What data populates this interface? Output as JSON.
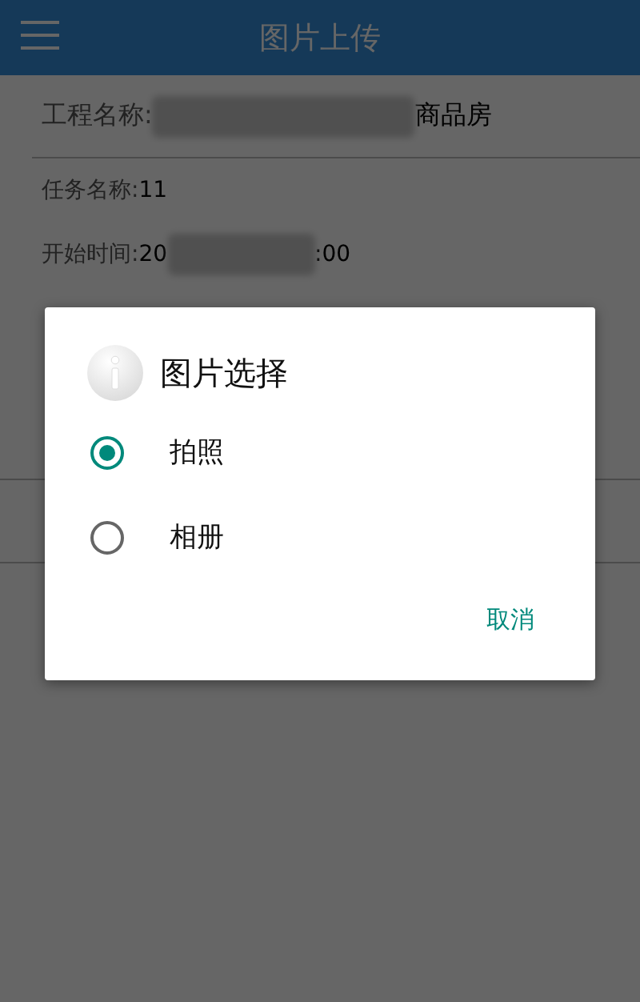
{
  "app_bar": {
    "title": "图片上传"
  },
  "fields": [
    {
      "label": "工程名称:",
      "blurred": true,
      "suffix": "商品房",
      "kind": "large"
    },
    {
      "label": "任务名称:",
      "value": "11",
      "kind": "small"
    },
    {
      "label": "开始时间:",
      "value": "20",
      "blurred": true,
      "suffix": ":00",
      "kind": "small"
    }
  ],
  "dialog": {
    "title": "图片选择",
    "options": [
      {
        "label": "拍照",
        "selected": true
      },
      {
        "label": "相册",
        "selected": false
      }
    ],
    "cancel": "取消"
  }
}
